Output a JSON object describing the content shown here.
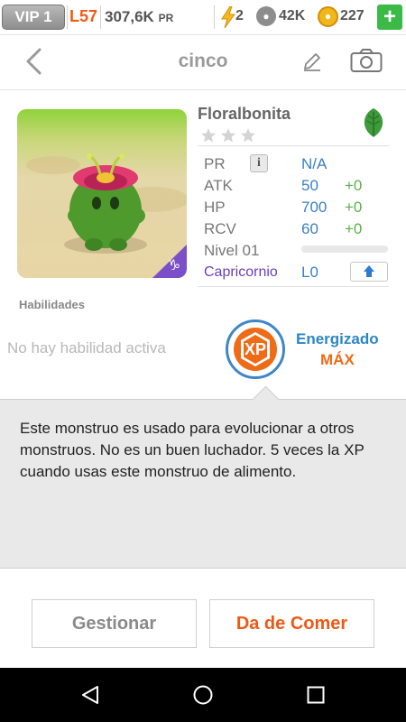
{
  "status_bar": {
    "vip": "VIP 1",
    "level": "L57",
    "power": "307,6K",
    "power_unit": "PR",
    "energy": "2",
    "paws": "42K",
    "coins": "227",
    "add_label": "+"
  },
  "header": {
    "title": "cinco"
  },
  "monster": {
    "name": "Floralbonita",
    "element_icon": "leaf-icon",
    "stars": 3,
    "corner_badge": "♑",
    "stats": {
      "pr_label": "PR",
      "info_label": "i",
      "pr_value": "N/A",
      "atk_label": "ATK",
      "atk_value": "50",
      "atk_bonus": "+0",
      "hp_label": "HP",
      "hp_value": "700",
      "hp_bonus": "+0",
      "rcv_label": "RCV",
      "rcv_value": "60",
      "rcv_bonus": "+0"
    },
    "level_label": "Nivel 01",
    "level_progress": 0,
    "zodiac": "Capricornio",
    "zodiac_level": "L0"
  },
  "skills": {
    "title": "Habilidades",
    "empty": "No hay habilidad activa",
    "badge_text": "XP",
    "status": "Energizado",
    "status_level": "MÁX"
  },
  "description": "Este monstruo es usado para evolucionar a otros monstruos. No es un buen luchador. 5 veces la XP cuando usas este monstruo de alimento.",
  "buttons": {
    "manage": "Gestionar",
    "feed": "Da de Comer"
  },
  "colors": {
    "accent_orange": "#ec5a16",
    "accent_blue": "#3a7fc4",
    "bonus_green": "#5ab04a",
    "zodiac_purple": "#6a3fbf"
  }
}
